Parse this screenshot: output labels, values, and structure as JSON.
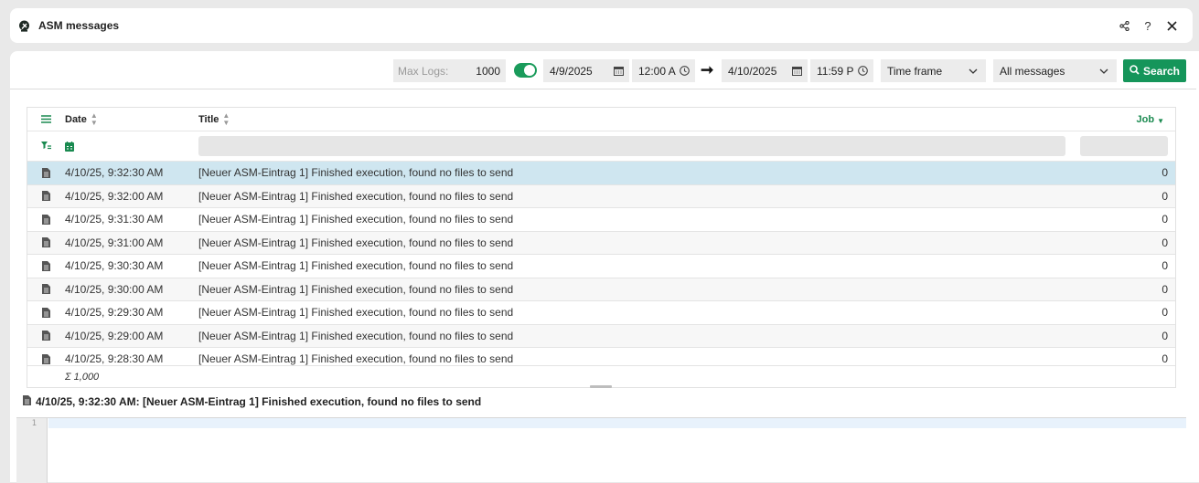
{
  "window": {
    "title": "ASM messages",
    "tools": [
      "share-icon",
      "help-icon",
      "close-icon"
    ]
  },
  "toolbar": {
    "max_logs_label": "Max Logs:",
    "max_logs_value": "1000",
    "live_toggle_on": true,
    "from_date": "4/9/2025",
    "from_time": "12:00 A",
    "to_date": "4/10/2025",
    "to_time": "11:59 P",
    "timeframe_label": "Time frame",
    "filter_label": "All messages",
    "search_label": "Search"
  },
  "grid": {
    "columns": {
      "date": "Date",
      "title": "Title",
      "job": "Job"
    },
    "rows": [
      {
        "date": "4/10/25, 9:32:30 AM",
        "title": "[Neuer ASM-Eintrag 1] Finished execution, found no files to send",
        "job": "0"
      },
      {
        "date": "4/10/25, 9:32:00 AM",
        "title": "[Neuer ASM-Eintrag 1] Finished execution, found no files to send",
        "job": "0"
      },
      {
        "date": "4/10/25, 9:31:30 AM",
        "title": "[Neuer ASM-Eintrag 1] Finished execution, found no files to send",
        "job": "0"
      },
      {
        "date": "4/10/25, 9:31:00 AM",
        "title": "[Neuer ASM-Eintrag 1] Finished execution, found no files to send",
        "job": "0"
      },
      {
        "date": "4/10/25, 9:30:30 AM",
        "title": "[Neuer ASM-Eintrag 1] Finished execution, found no files to send",
        "job": "0"
      },
      {
        "date": "4/10/25, 9:30:00 AM",
        "title": "[Neuer ASM-Eintrag 1] Finished execution, found no files to send",
        "job": "0"
      },
      {
        "date": "4/10/25, 9:29:30 AM",
        "title": "[Neuer ASM-Eintrag 1] Finished execution, found no files to send",
        "job": "0"
      },
      {
        "date": "4/10/25, 9:29:00 AM",
        "title": "[Neuer ASM-Eintrag 1] Finished execution, found no files to send",
        "job": "0"
      },
      {
        "date": "4/10/25, 9:28:30 AM",
        "title": "[Neuer ASM-Eintrag 1] Finished execution, found no files to send",
        "job": "0"
      }
    ],
    "footer_count": "Σ 1,000"
  },
  "detail": {
    "title": "4/10/25, 9:32:30 AM: [Neuer ASM-Eintrag 1] Finished execution, found no files to send",
    "line_number": "1"
  },
  "colors": {
    "accent": "#15955a",
    "selected_row": "#cfe6f0"
  }
}
